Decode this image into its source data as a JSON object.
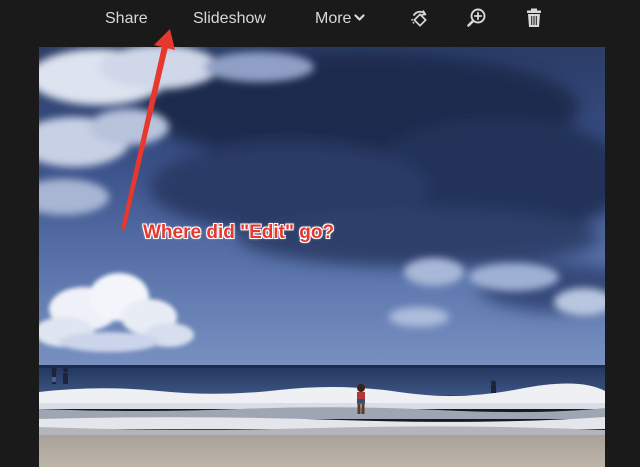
{
  "toolbar": {
    "share_label": "Share",
    "slideshow_label": "Slideshow",
    "more_label": "More",
    "icons": [
      "rotate-icon",
      "zoom-in-icon",
      "trash-icon",
      "chevron-down-icon"
    ]
  },
  "annotation": {
    "text": "Where did \"Edit\" go?",
    "color": "#e8382e"
  },
  "colors": {
    "background": "#1a1a1a",
    "toolbar_text": "#d8d8d8"
  }
}
